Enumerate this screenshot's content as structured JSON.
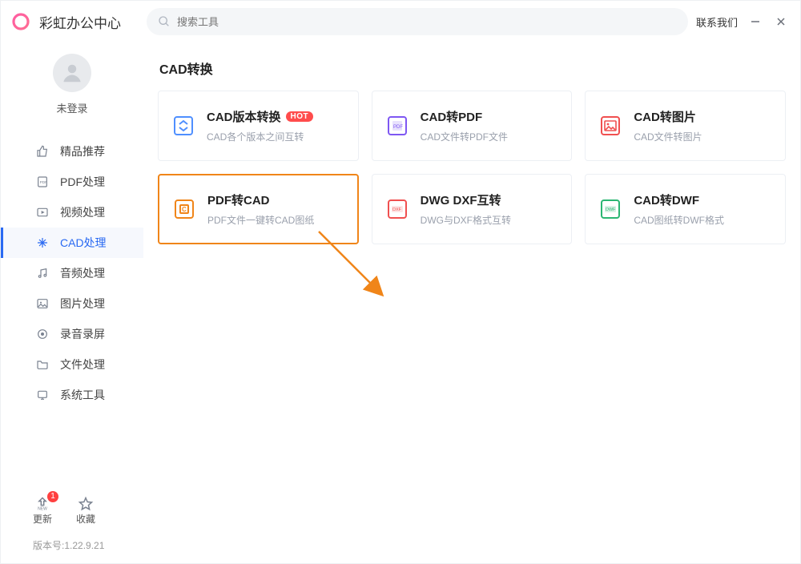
{
  "titlebar": {
    "app_title": "彩虹办公中心",
    "search_placeholder": "搜索工具",
    "contact_label": "联系我们"
  },
  "sidebar": {
    "login_state": "未登录",
    "items": [
      {
        "label": "精品推荐",
        "icon": "thumb-up-icon"
      },
      {
        "label": "PDF处理",
        "icon": "pdf-icon"
      },
      {
        "label": "视频处理",
        "icon": "video-icon"
      },
      {
        "label": "CAD处理",
        "icon": "cad-icon"
      },
      {
        "label": "音频处理",
        "icon": "audio-icon"
      },
      {
        "label": "图片处理",
        "icon": "image-icon"
      },
      {
        "label": "录音录屏",
        "icon": "record-icon"
      },
      {
        "label": "文件处理",
        "icon": "folder-icon"
      },
      {
        "label": "系统工具",
        "icon": "system-icon"
      }
    ],
    "active_index": 3,
    "update_label": "更新",
    "update_badge": "1",
    "favorite_label": "收藏",
    "version_prefix": "版本号:",
    "version": "1.22.9.21"
  },
  "main": {
    "section_title": "CAD转换",
    "cards": [
      {
        "title": "CAD版本转换",
        "subtitle": "CAD各个版本之间互转",
        "icon_color": "#4F8FFF",
        "hot": true,
        "hot_label": "HOT"
      },
      {
        "title": "CAD转PDF",
        "subtitle": "CAD文件转PDF文件",
        "icon_color": "#7E57F2"
      },
      {
        "title": "CAD转图片",
        "subtitle": "CAD文件转图片",
        "icon_color": "#F05050"
      },
      {
        "title": "PDF转CAD",
        "subtitle": "PDF文件一键转CAD图纸",
        "icon_color": "#F08519",
        "highlight": true
      },
      {
        "title": "DWG DXF互转",
        "subtitle": "DWG与DXF格式互转",
        "icon_color": "#F05050"
      },
      {
        "title": "CAD转DWF",
        "subtitle": "CAD图纸转DWF格式",
        "icon_color": "#2BB673"
      }
    ]
  }
}
